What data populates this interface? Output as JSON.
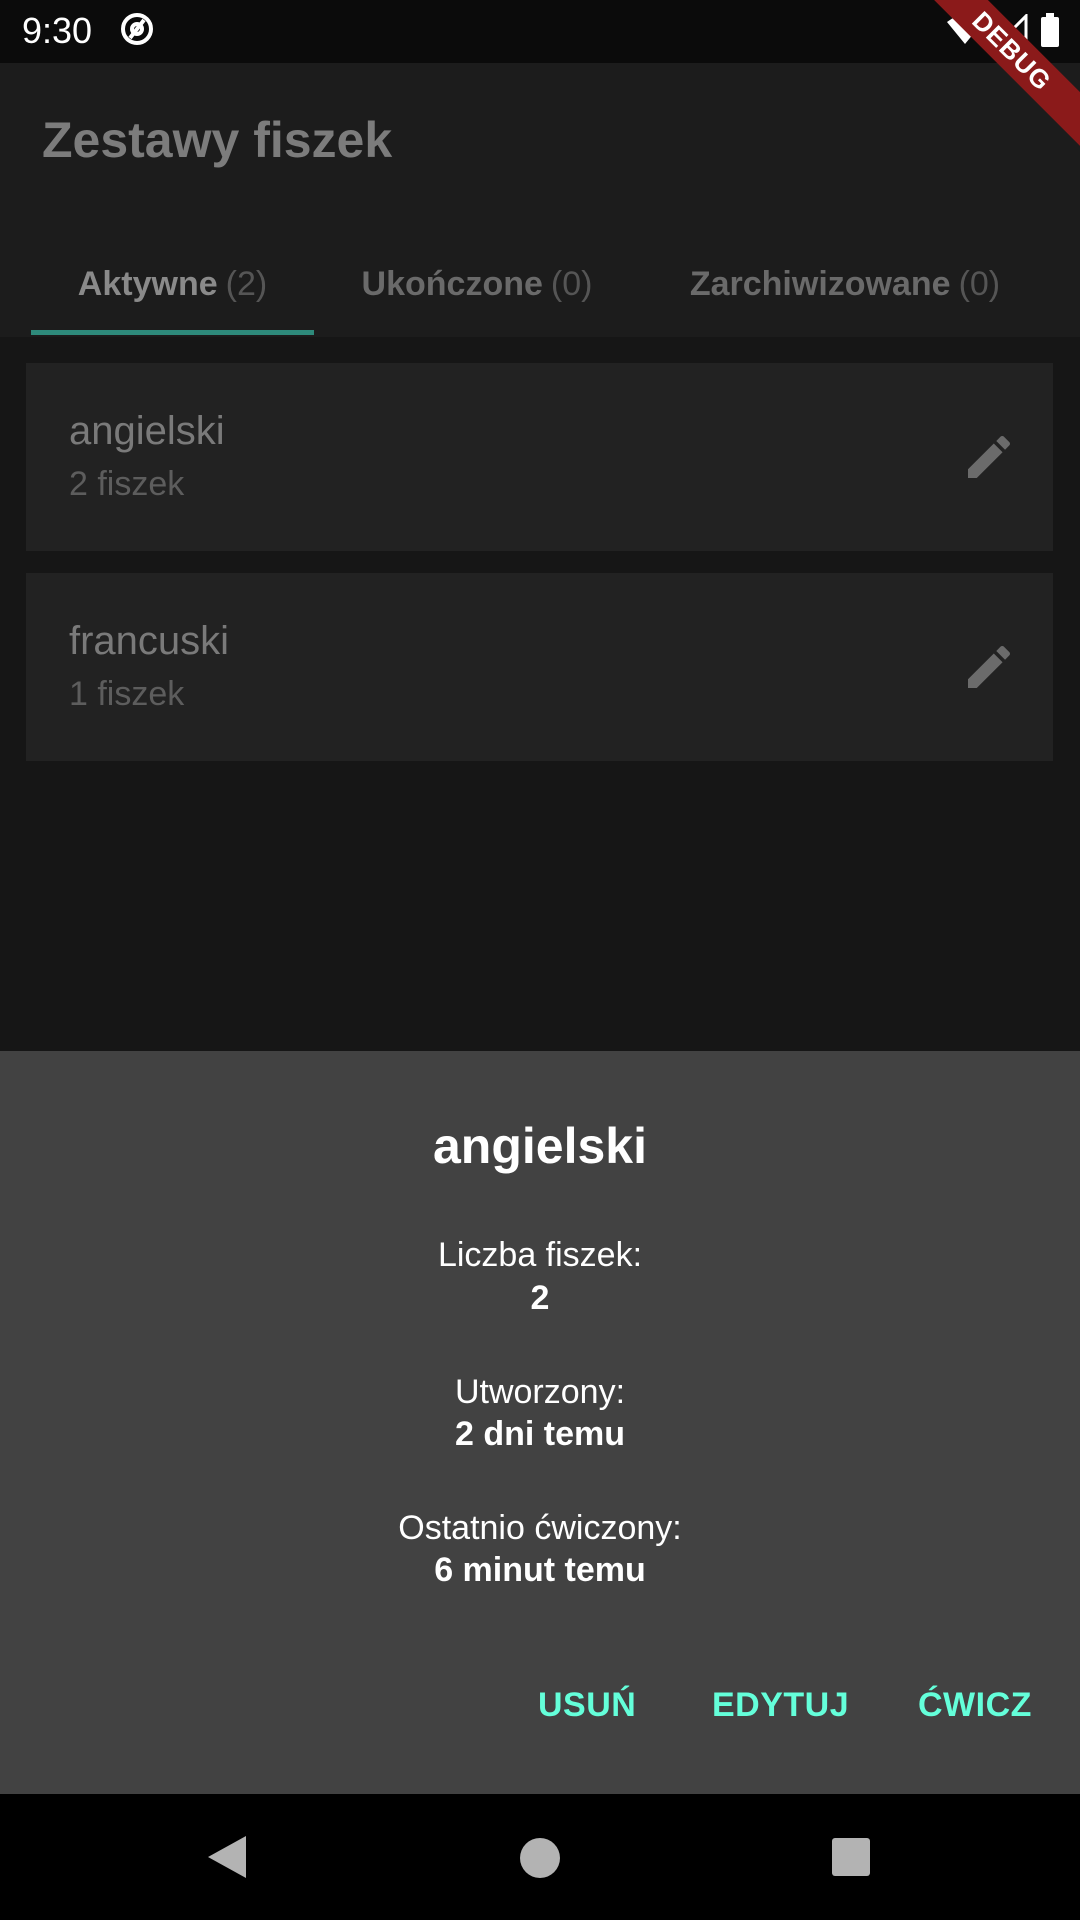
{
  "status_bar": {
    "time": "9:30",
    "icons": [
      "at-sign-icon",
      "wifi-icon",
      "signal-icon",
      "battery-icon"
    ],
    "debug_label": "DEBUG"
  },
  "app_bar": {
    "title": "Zestawy fiszek",
    "tabs": [
      {
        "label": "Aktywne",
        "count": "(2)",
        "active": true
      },
      {
        "label": "Ukończone",
        "count": "(0)",
        "active": false
      },
      {
        "label": "Zarchiwizowane",
        "count": "(0)",
        "active": false
      }
    ],
    "indicator_color": "#2e8a7b"
  },
  "sets": [
    {
      "name": "angielski",
      "count_text": "2 fiszek",
      "icon": "pencil-icon"
    },
    {
      "name": "francuski",
      "count_text": "1 fiszek",
      "icon": "pencil-icon"
    }
  ],
  "sheet": {
    "title": "angielski",
    "info": [
      {
        "label": "Liczba fiszek:",
        "value": "2"
      },
      {
        "label": "Utworzony:",
        "value": "2 dni temu"
      },
      {
        "label": "Ostatnio ćwiczony:",
        "value": "6 minut temu"
      }
    ],
    "actions": {
      "delete": "USUŃ",
      "edit": "EDYTUJ",
      "practice": "ĆWICZ"
    },
    "accent_color": "#64ffda"
  },
  "nav_bar": {
    "icons": [
      "back-icon",
      "home-icon",
      "recents-icon"
    ]
  }
}
